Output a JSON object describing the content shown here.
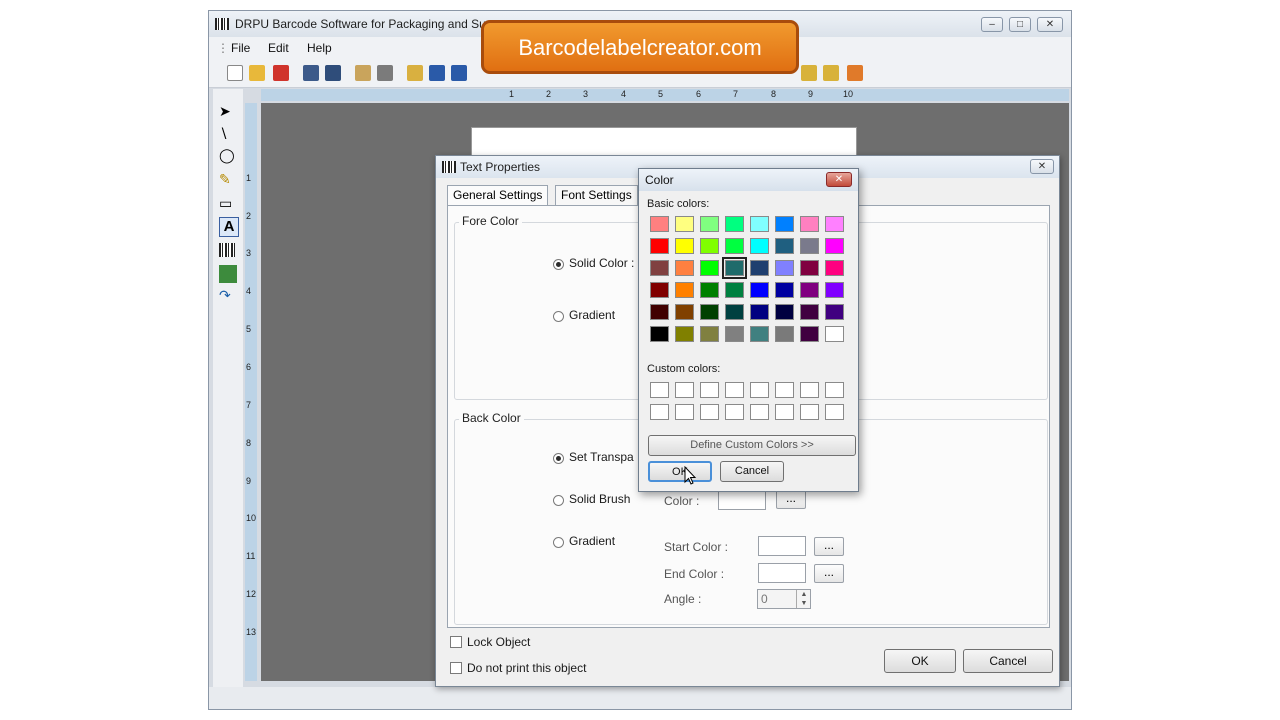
{
  "app": {
    "title": "DRPU Barcode Software for Packaging and Sup",
    "menu": [
      "File",
      "Edit",
      "Help"
    ],
    "ruler_top": [
      "1",
      "2",
      "3",
      "4",
      "5",
      "6",
      "7",
      "8",
      "9",
      "10"
    ],
    "ruler_left": [
      "1",
      "2",
      "3",
      "4",
      "5",
      "6",
      "7",
      "8",
      "9",
      "10",
      "11",
      "12",
      "13"
    ]
  },
  "banner": {
    "text": "Barcodelabelcreator.com"
  },
  "text_properties": {
    "title": "Text Properties",
    "tabs": [
      "General Settings",
      "Font Settings"
    ],
    "fore_color": {
      "title": "Fore Color",
      "solid_color_label": "Solid Color :",
      "gradient_label": "Gradient",
      "selected": "Solid Color"
    },
    "back_color": {
      "title": "Back Color",
      "set_transparent_label": "Set Transpa",
      "solid_brush_label": "Solid Brush",
      "gradient_label": "Gradient",
      "color_label": "Color :",
      "start_color_label": "Start Color :",
      "end_color_label": "End Color :",
      "angle_label": "Angle :",
      "angle_value": "0",
      "browse_label": "...",
      "selected": "Set Transparent"
    },
    "lock_object_label": "Lock Object",
    "no_print_label": "Do not print this object",
    "ok_label": "OK",
    "cancel_label": "Cancel"
  },
  "color_dialog": {
    "title": "Color",
    "basic_colors_label": "Basic colors:",
    "custom_colors_label": "Custom colors:",
    "define_custom_label": "Define Custom Colors >>",
    "ok_label": "OK",
    "cancel_label": "Cancel",
    "selected_index": 19,
    "basic_colors": [
      "#ff8080",
      "#ffff80",
      "#80ff80",
      "#00ff80",
      "#80ffff",
      "#0080ff",
      "#ff80c0",
      "#ff80ff",
      "#ff0000",
      "#ffff00",
      "#80ff00",
      "#00ff40",
      "#00ffff",
      "#1f5f80",
      "#7a7a8c",
      "#ff00ff",
      "#804040",
      "#ff8040",
      "#00ff00",
      "#1f6b6b",
      "#1f3f6f",
      "#8080ff",
      "#800040",
      "#ff0080",
      "#800000",
      "#ff8000",
      "#008000",
      "#008040",
      "#0000ff",
      "#0000a0",
      "#800080",
      "#8000ff",
      "#400000",
      "#804000",
      "#004000",
      "#004040",
      "#000080",
      "#000040",
      "#400040",
      "#400080",
      "#000000",
      "#808000",
      "#808040",
      "#808080",
      "#408080",
      "#7a7a7a",
      "#400040",
      "#ffffff"
    ]
  }
}
